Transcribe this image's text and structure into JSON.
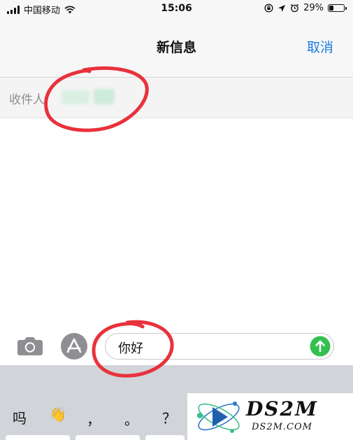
{
  "status_bar": {
    "carrier": "中国移动",
    "time": "15:06",
    "battery_percent": "29%",
    "battery_level": 0.29,
    "icons": [
      "signal-icon",
      "wifi-icon",
      "lock-rotation-icon",
      "location-icon",
      "alarm-icon",
      "battery-icon"
    ]
  },
  "header": {
    "title": "新信息",
    "cancel_label": "取消"
  },
  "recipient": {
    "label": "收件人"
  },
  "composer": {
    "message_text": "你好",
    "icons": [
      "camera-icon",
      "app-store-icon",
      "send-arrow-icon"
    ]
  },
  "keyboard": {
    "suggestions": [
      "吗",
      "👋",
      "，",
      "。",
      "？"
    ]
  },
  "watermark": {
    "title": "DS2M",
    "url": "DS2M.COM"
  },
  "colors": {
    "accent": "#1e7be0",
    "send_button": "#33c04f",
    "annotation": "#e8323c",
    "keyboard_bg": "#d1d4d9"
  }
}
